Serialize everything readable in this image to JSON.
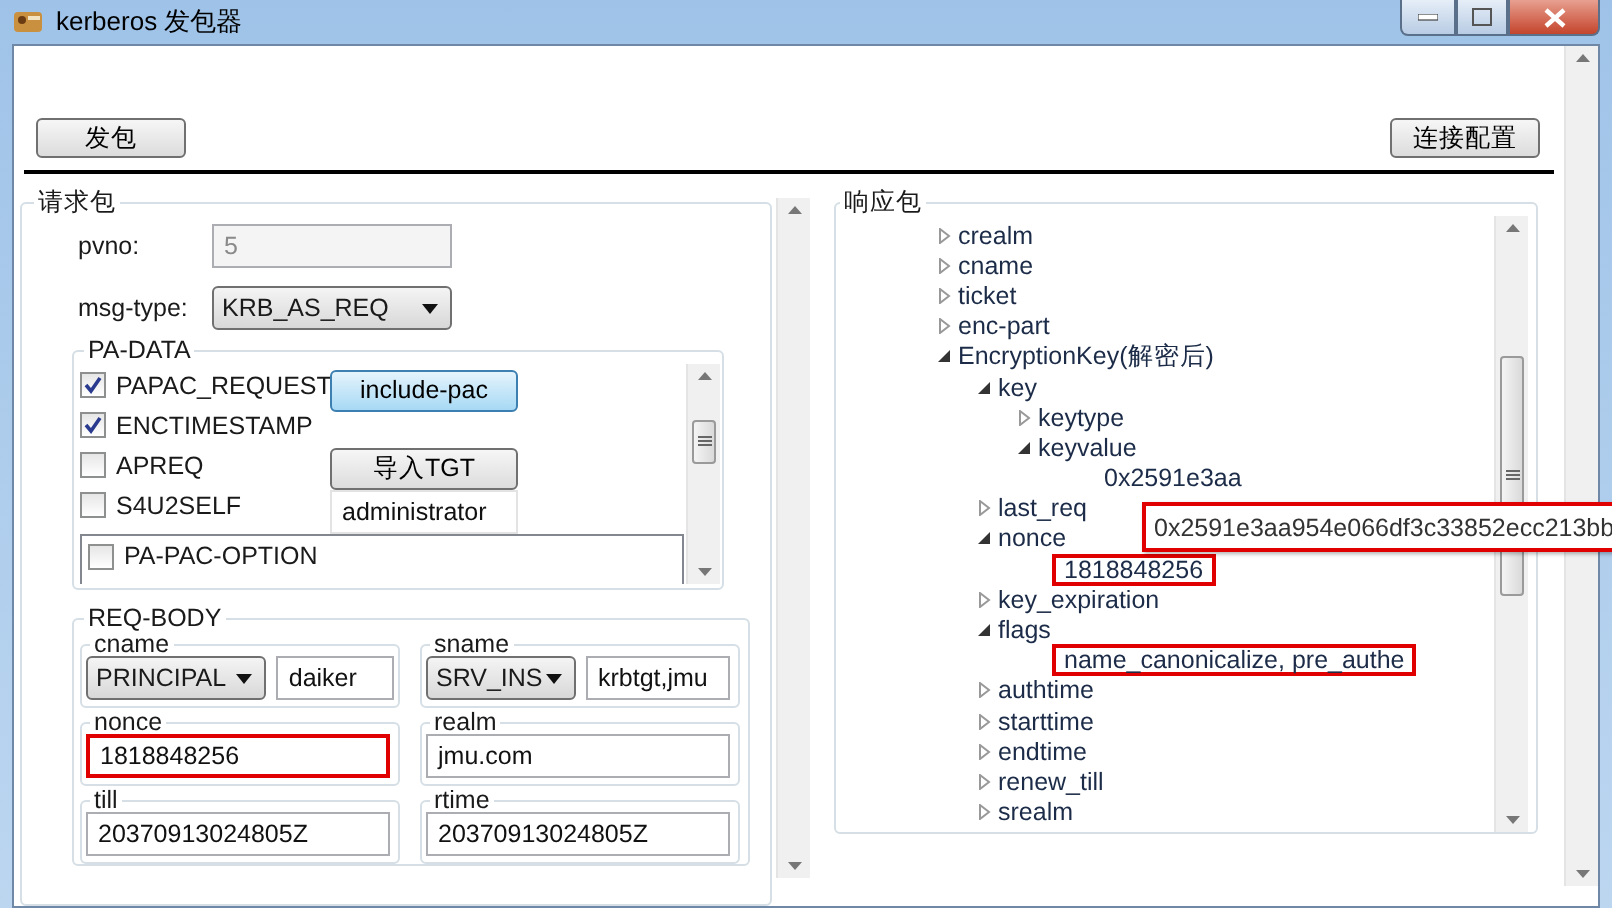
{
  "window": {
    "title": "kerberos 发包器"
  },
  "toolbar": {
    "send_button": "发包",
    "config_button": "连接配置"
  },
  "request": {
    "title": "请求包",
    "pvno": {
      "label": "pvno:",
      "value": "5",
      "disabled": true
    },
    "msg_type": {
      "label": "msg-type:",
      "value": "KRB_AS_REQ"
    },
    "pa_data": {
      "title": "PA-DATA",
      "options": [
        {
          "label": "PAPAC_REQUEST",
          "checked": true
        },
        {
          "label": "ENCTIMESTAMP",
          "checked": true
        },
        {
          "label": "APREQ",
          "checked": false
        },
        {
          "label": "S4U2SELF",
          "checked": false
        }
      ],
      "include_pac_button": "include-pac",
      "import_tgt_button": "导入TGT",
      "user_value": "administrator",
      "pac_option": {
        "label": "PA-PAC-OPTION",
        "checked": false
      }
    },
    "req_body": {
      "title": "REQ-BODY",
      "cname": {
        "label": "cname",
        "type": "PRINCIPAL",
        "value": "daiker"
      },
      "sname": {
        "label": "sname",
        "type": "SRV_INS",
        "value": "krbtgt,jmu"
      },
      "fields": [
        {
          "label": "nonce",
          "value": "1818848256",
          "highlighted": true
        },
        {
          "label": "realm",
          "value": "jmu.com",
          "highlighted": false
        },
        {
          "label": "till",
          "value": "20370913024805Z",
          "highlighted": false
        },
        {
          "label": "rtime",
          "value": "20370913024805Z",
          "highlighted": false
        }
      ]
    }
  },
  "response": {
    "title": "响应包",
    "tree": [
      {
        "label": "crealm",
        "expanded": false
      },
      {
        "label": "cname",
        "expanded": false
      },
      {
        "label": "ticket",
        "expanded": false
      },
      {
        "label": "enc-part",
        "expanded": false
      },
      {
        "label": "EncryptionKey(解密后)",
        "expanded": true,
        "children": [
          {
            "label": "key",
            "expanded": true,
            "children": [
              {
                "label": "keytype",
                "expanded": false
              },
              {
                "label": "keyvalue",
                "expanded": true,
                "children": [
                  {
                    "label": "0x2591e3aa",
                    "highlighted": false
                  }
                ]
              }
            ]
          },
          {
            "label": "last_req",
            "expanded": false
          },
          {
            "label": "nonce",
            "expanded": true,
            "children": [
              {
                "label": "1818848256",
                "highlighted": true
              }
            ]
          },
          {
            "label": "key_expiration",
            "expanded": false
          },
          {
            "label": "flags",
            "expanded": true,
            "children": [
              {
                "label": "name_canonicalize, pre_authe",
                "highlighted": true
              }
            ]
          },
          {
            "label": "authtime",
            "expanded": false
          },
          {
            "label": "starttime",
            "expanded": false
          },
          {
            "label": "endtime",
            "expanded": false
          },
          {
            "label": "renew_till",
            "expanded": false
          },
          {
            "label": "srealm",
            "expanded": false
          }
        ]
      }
    ]
  },
  "tooltip": {
    "text": "0x2591e3aa954e066df3c33852ecc213bb"
  }
}
